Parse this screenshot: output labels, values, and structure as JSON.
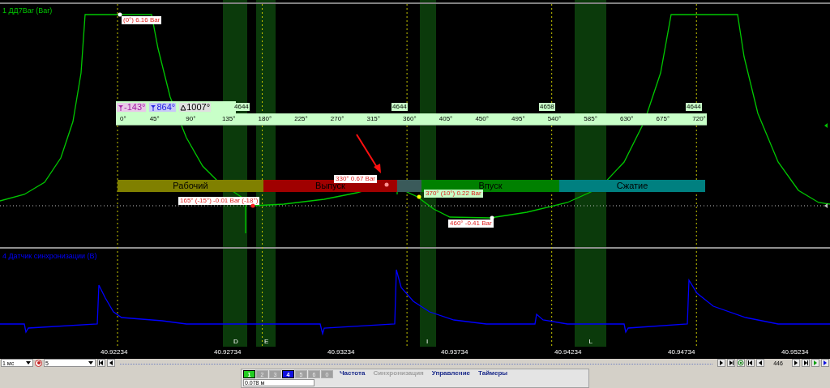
{
  "channels": [
    {
      "label": "1 ДД7Bar (Bar)",
      "color": "#00c800"
    },
    {
      "label": "4 Датчик синхронизации (В)",
      "color": "#0000ff"
    }
  ],
  "markers": [
    {
      "text": "(0°) 6.16 Bar",
      "color": "#ffffff"
    },
    {
      "text": "165° (-15°) -0.01 Bar (-18°)",
      "color": "#ff2020"
    },
    {
      "text": "330° 0.67 Bar",
      "color": "#ff9090"
    },
    {
      "text": "370° (10°) 0.22 Bar",
      "color": "#ffff00"
    },
    {
      "text": "460° -0.41 Bar",
      "color": "#ffffff"
    }
  ],
  "cursors": {
    "left": "-143°",
    "right": "864°",
    "delta": "1007°"
  },
  "rpm_labels": [
    "4644",
    "4644",
    "4658",
    "4644"
  ],
  "degree_ticks": [
    "0°",
    "45°",
    "90°",
    "135°",
    "180°",
    "225°",
    "270°",
    "315°",
    "360°",
    "405°",
    "450°",
    "495°",
    "540°",
    "585°",
    "630°",
    "675°",
    "720°"
  ],
  "phases": [
    {
      "label": "Рабочий",
      "color": "#808000"
    },
    {
      "label": "Выпуск",
      "color": "#a00000"
    },
    {
      "label": "Впуск",
      "color": "#008000"
    },
    {
      "label": "Сжатие",
      "color": "#008080"
    }
  ],
  "zones": [
    "D",
    "E",
    "I",
    "L"
  ],
  "time_ticks": [
    "40.92234",
    "40.92734",
    "40.93234",
    "40.93734",
    "40.94234",
    "40.94734",
    "40.95234"
  ],
  "toolbar": {
    "timebase": "1 мс",
    "count": "5",
    "frame": "446",
    "distance": "0.078 м",
    "channel_buttons": [
      {
        "label": "1",
        "selected": true,
        "color": "#22cc22"
      },
      {
        "label": "2",
        "selected": false,
        "color": "#a0a0a0"
      },
      {
        "label": "3",
        "selected": false,
        "color": "#a0a0a0"
      },
      {
        "label": "4",
        "selected": true,
        "color": "#1010e0"
      },
      {
        "label": "5",
        "selected": false,
        "color": "#a0a0a0"
      },
      {
        "label": "6",
        "selected": false,
        "color": "#a0a0a0"
      },
      {
        "label": "0",
        "selected": false,
        "color": "#a0a0a0"
      }
    ],
    "groups": [
      {
        "title": "Частота",
        "disabled": false
      },
      {
        "title": "Синхронизация",
        "disabled": true
      },
      {
        "title": "Управление",
        "disabled": false
      },
      {
        "title": "Таймеры",
        "disabled": false
      }
    ]
  }
}
